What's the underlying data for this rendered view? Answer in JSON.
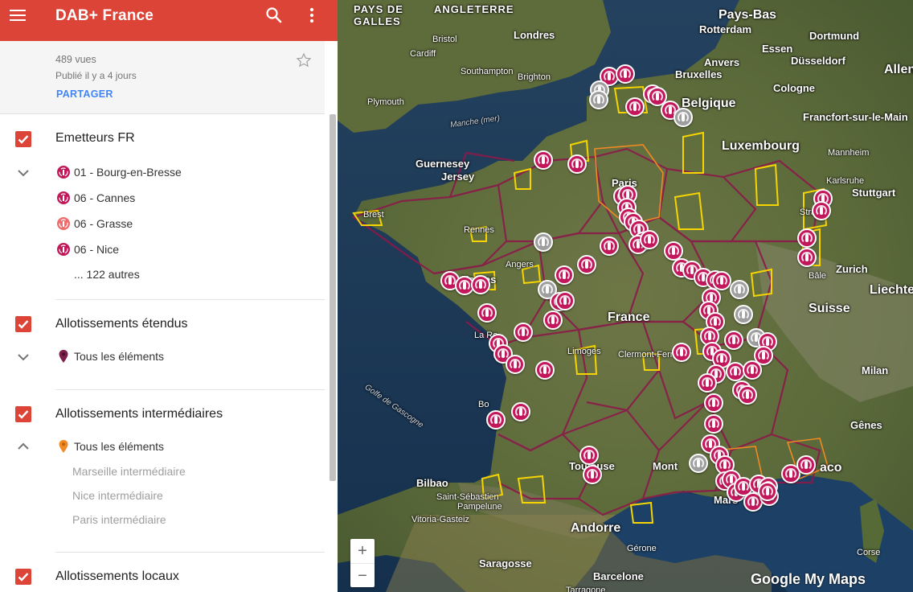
{
  "app": {
    "title": "DAB+ France",
    "views": "489 vues",
    "published": "Publié il y a 4 jours",
    "share_label": "PARTAGER"
  },
  "colors": {
    "header": "#db4437",
    "checkbox": "#db4437",
    "marker_red": "#c2185b",
    "marker_gray": "#9e9e9e",
    "region_border": "#8b1a4a",
    "allotment_yellow": "#f5d400",
    "allotment_orange": "#f08a24"
  },
  "layers": [
    {
      "title": "Emetteurs FR",
      "checked": true,
      "expanded": true,
      "items": [
        {
          "label": "01 - Bourg-en-Bresse",
          "icon": "transmitter-icon"
        },
        {
          "label": "06 - Cannes",
          "icon": "transmitter-icon"
        },
        {
          "label": "06 - Grasse",
          "icon": "transmitter-icon"
        },
        {
          "label": "06 - Nice",
          "icon": "transmitter-icon"
        }
      ],
      "more_label": "... 122 autres"
    },
    {
      "title": "Allotissements étendus",
      "checked": true,
      "expanded": true,
      "all_items_label": "Tous les éléments",
      "icon": "placemark-purple-icon"
    },
    {
      "title": "Allotissements intermédiaires",
      "checked": true,
      "expanded": true,
      "all_items_label": "Tous les éléments",
      "icon": "placemark-orange-icon",
      "subitems": [
        "Marseille intermédiaire",
        "Nice intermédiaire",
        "Paris intermédiaire"
      ]
    },
    {
      "title": "Allotissements locaux",
      "checked": true
    }
  ],
  "map": {
    "labels": {
      "pays_de_galles": "PAYS DE\nGALLES",
      "angleterre": "ANGLETERRE",
      "pays_bas": "Pays-Bas",
      "rotterdam": "Rotterdam",
      "londres": "Londres",
      "bristol": "Bristol",
      "cardiff": "Cardiff",
      "southampton": "Southampton",
      "brighton": "Brighton",
      "plymouth": "Plymouth",
      "anvers": "Anvers",
      "bruxelles": "Bruxelles",
      "belgique": "Belgique",
      "dortmund": "Dortmund",
      "essen": "Essen",
      "dusseldorf": "Düsseldorf",
      "cologne": "Cologne",
      "allemagne": "Allen",
      "francfort": "Francfort-sur-le-Main",
      "mannheim": "Mannheim",
      "karlsruhe": "Karlsruhe",
      "stuttgart": "Stuttgart",
      "luxembourg": "Luxembourg",
      "manche": "Manche (mer)",
      "guernesey": "Guernesey",
      "jersey": "Jersey",
      "paris": "Paris",
      "rennes": "Rennes",
      "brest": "Brest",
      "angers": "Angers",
      "nantes": "Nantes",
      "strasbourg": "Stras",
      "zurich": "Zurich",
      "bale": "Bâle",
      "liechtenstein": "Liechten",
      "suisse": "Suisse",
      "france": "France",
      "la_rochelle": "La Ro",
      "limoges": "Limoges",
      "clermont": "Clermont-Ferr",
      "golfe": "Golfe de Gascogne",
      "bordeaux": "Bo",
      "milan": "Milan",
      "genes": "Gênes",
      "toulouse": "Toulouse",
      "montpellier": "Mont",
      "monaco": "aco",
      "bilbao": "Bilbao",
      "saint_sebastien": "Saint-Sébastien",
      "pampelune": "Pampelune",
      "vitoria": "Vitoria-Gasteiz",
      "andorre": "Andorre",
      "marseille": "Mars",
      "saragosse": "Saragosse",
      "gerone": "Gérone",
      "barcelone": "Barcelone",
      "tarragone": "Tarragone",
      "corse": "Corse"
    },
    "zoom_in": "+",
    "zoom_out": "−",
    "brand": "Google My Maps"
  }
}
